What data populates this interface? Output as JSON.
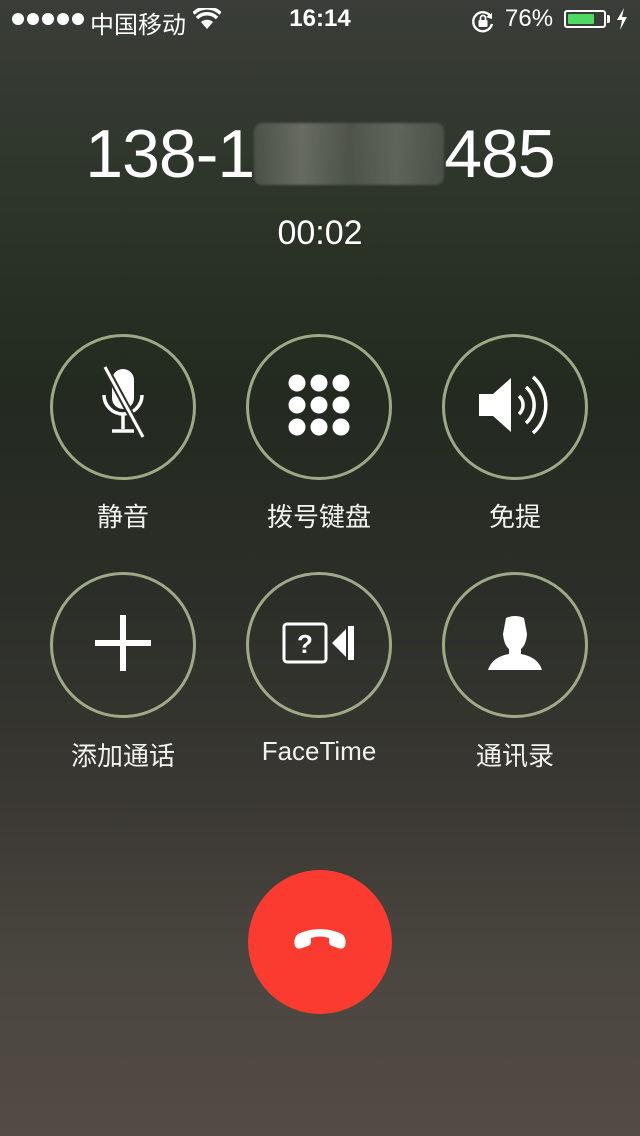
{
  "status_bar": {
    "carrier": "中国移动",
    "time": "16:14",
    "battery_percent": "76%",
    "battery_level": 0.76,
    "battery_color": "#4cd964",
    "icons": [
      "signal-dots",
      "wifi-icon",
      "rotation-lock-icon",
      "battery-icon",
      "charging-bolt-icon"
    ]
  },
  "call": {
    "number_prefix": "138-1",
    "number_suffix": "485",
    "duration": "00:02"
  },
  "controls": [
    {
      "id": "mute",
      "label": "静音",
      "icon": "mic-muted-icon"
    },
    {
      "id": "keypad",
      "label": "拨号键盘",
      "icon": "keypad-icon"
    },
    {
      "id": "speaker",
      "label": "免提",
      "icon": "speaker-icon"
    },
    {
      "id": "add-call",
      "label": "添加通话",
      "icon": "plus-icon"
    },
    {
      "id": "facetime",
      "label": "FaceTime",
      "icon": "facetime-icon"
    },
    {
      "id": "contacts",
      "label": "通讯录",
      "icon": "contact-icon"
    }
  ],
  "end_call": {
    "icon": "phone-hangup-icon",
    "color": "#fb3b30"
  }
}
